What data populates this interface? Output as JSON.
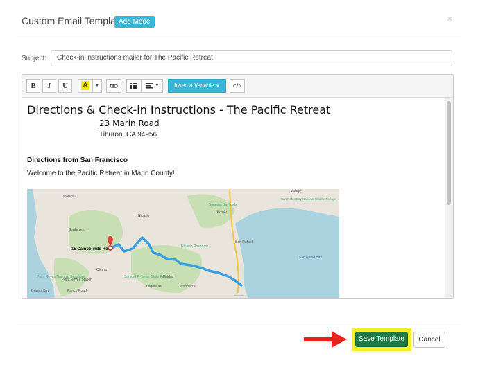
{
  "header": {
    "title": "Custom Email Template",
    "add_mode": "Add Mode",
    "close": "×"
  },
  "subject": {
    "label": "Subject:",
    "value": "Check-in instructions mailer for The Pacific Retreat"
  },
  "toolbar": {
    "bold": "B",
    "italic": "I",
    "underline": "U",
    "highlight": "A",
    "insert_variable": "Insert a Variable",
    "code_view": "</>"
  },
  "content": {
    "heading": "Directions & Check-in Instructions - The Pacific Retreat",
    "street": "23 Marin Road",
    "city": "Tiburon, CA 94956",
    "directions_heading": "Directions from San Francisco",
    "welcome": "Welcome to the Pacific Retreat in Marin County!"
  },
  "map": {
    "marker_label": "15 Campolindo Rd",
    "places": [
      "Marshall",
      "Seahaven",
      "Olema",
      "Nicasio",
      "Novato",
      "San Rafael",
      "Point Reyes Station",
      "Woodacre",
      "Fairfax",
      "Lagunitas",
      "Point Reyes National Seashore",
      "Samuel P. Taylor State Park",
      "Drakes Bay",
      "Ranch Road",
      "Nicasio Reservoir",
      "San Pablo Bay",
      "Vallejo",
      "San Pablo Bay National Wildlife Refuge",
      "Sonoma Baylands"
    ]
  },
  "footer": {
    "save": "Save Template",
    "cancel": "Cancel"
  },
  "colors": {
    "accent": "#39b6d8",
    "save": "#1f7a47",
    "highlight": "#f3ef2a",
    "arrow": "#e8231e"
  }
}
